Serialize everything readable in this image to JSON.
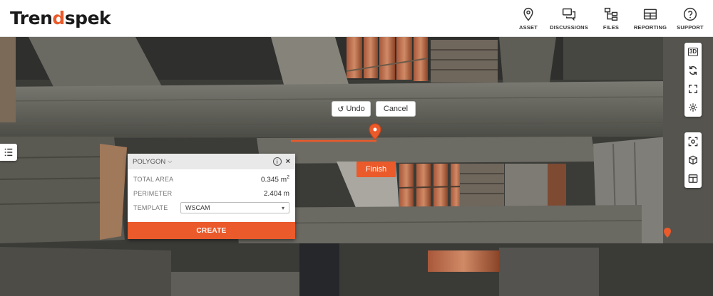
{
  "brand": {
    "logo_text_a": "Tren",
    "logo_text_b": "d",
    "logo_text_c": "spek"
  },
  "nav": [
    {
      "label": "ASSET",
      "icon": "map-pin-icon"
    },
    {
      "label": "DISCUSSIONS",
      "icon": "chat-bubbles-icon"
    },
    {
      "label": "FILES",
      "icon": "folder-tree-icon"
    },
    {
      "label": "REPORTING",
      "icon": "table-icon"
    },
    {
      "label": "SUPPORT",
      "icon": "help-circle-icon"
    }
  ],
  "toolbar": {
    "view3d_label": "3D",
    "top": [
      "3d-view-icon",
      "rotate-icon",
      "fullscreen-icon",
      "settings-icon"
    ],
    "bottom": [
      "focus-icon",
      "cube-icon",
      "split-view-icon"
    ]
  },
  "measure": {
    "undo_label": "Undo",
    "cancel_label": "Cancel",
    "finish_label": "Finish"
  },
  "panel": {
    "mode": "POLYGON",
    "total_area_label": "TOTAL AREA",
    "total_area_value": "0.345 m",
    "total_area_unit_sup": "2",
    "perimeter_label": "PERIMETER",
    "perimeter_value": "2.404 m",
    "template_label": "TEMPLATE",
    "template_value": "WSCAM",
    "create_label": "CREATE"
  },
  "colors": {
    "accent": "#ea5a2b",
    "header_bg": "#ffffff"
  }
}
